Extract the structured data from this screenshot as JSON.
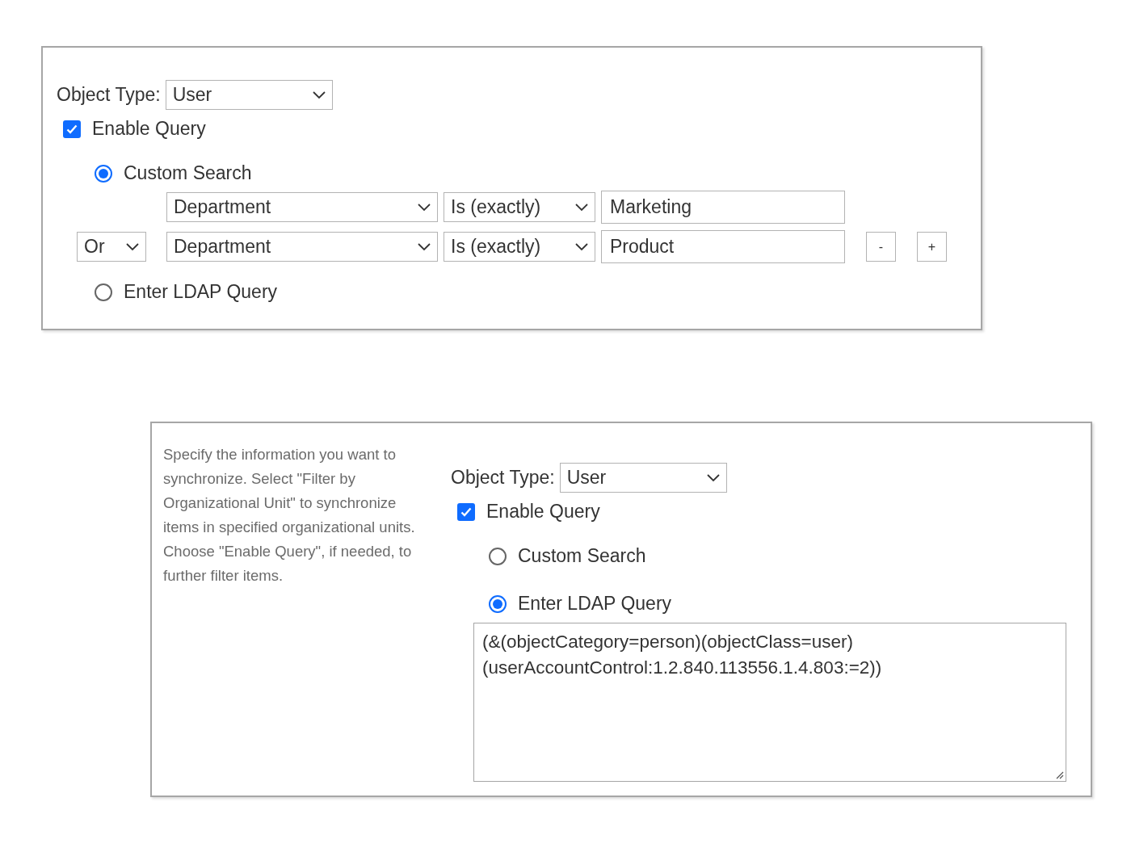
{
  "panels": [
    {
      "object_type": {
        "label": "Object Type:",
        "value": "User"
      },
      "enable_query": {
        "label": "Enable Query",
        "checked": true
      },
      "options": [
        {
          "kind": "custom",
          "label": "Custom Search",
          "selected": true,
          "conditions": [
            {
              "field": "Department",
              "operator": "Is (exactly)",
              "value": "Marketing"
            },
            {
              "connector": "Or",
              "field": "Department",
              "operator": "Is (exactly)",
              "value": "Product",
              "buttons": [
                "-",
                "+"
              ]
            }
          ]
        },
        {
          "kind": "ldap",
          "label": "Enter LDAP Query",
          "selected": false
        }
      ]
    },
    {
      "description": "Specify the information you want to synchronize. Select \"Filter by Organizational Unit\" to synchronize items in specified organizational units. Choose \"Enable Query\", if needed, to further filter items.",
      "object_type": {
        "label": "Object Type:",
        "value": "User"
      },
      "enable_query": {
        "label": "Enable Query",
        "checked": true
      },
      "options": [
        {
          "kind": "custom",
          "label": "Custom Search",
          "selected": false
        },
        {
          "kind": "ldap",
          "label": "Enter LDAP Query",
          "selected": true,
          "query_lines": [
            "(&(objectCategory=person)(objectClass=user)",
            "(userAccountControl:1.2.840.113556.1.4.803:=2))"
          ]
        }
      ]
    }
  ]
}
